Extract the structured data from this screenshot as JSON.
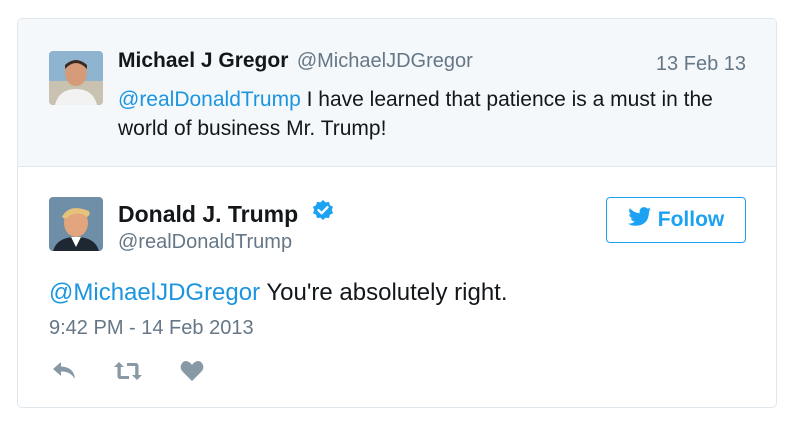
{
  "parent_tweet": {
    "author_name": "Michael J Gregor",
    "author_handle": "@MichaelJDGregor",
    "date": "13 Feb 13",
    "mention": "@realDonaldTrump",
    "text": " I have learned that patience is a must in the world of business Mr. Trump!"
  },
  "main_tweet": {
    "author_name": "Donald J. Trump",
    "author_handle": "@realDonaldTrump",
    "verified_icon": "verified-badge-icon",
    "follow_label": "Follow",
    "mention": "@MichaelJDGregor",
    "text": " You're absolutely right.",
    "timestamp": "9:42 PM - 14 Feb 2013"
  },
  "actions": {
    "reply_icon": "reply-icon",
    "retweet_icon": "retweet-icon",
    "like_icon": "heart-icon"
  },
  "colors": {
    "accent": "#1da1f2",
    "mention": "#1b95e0",
    "secondary_text": "#657786",
    "parent_bg": "#f5f8fa",
    "border": "#e1e8ed"
  }
}
